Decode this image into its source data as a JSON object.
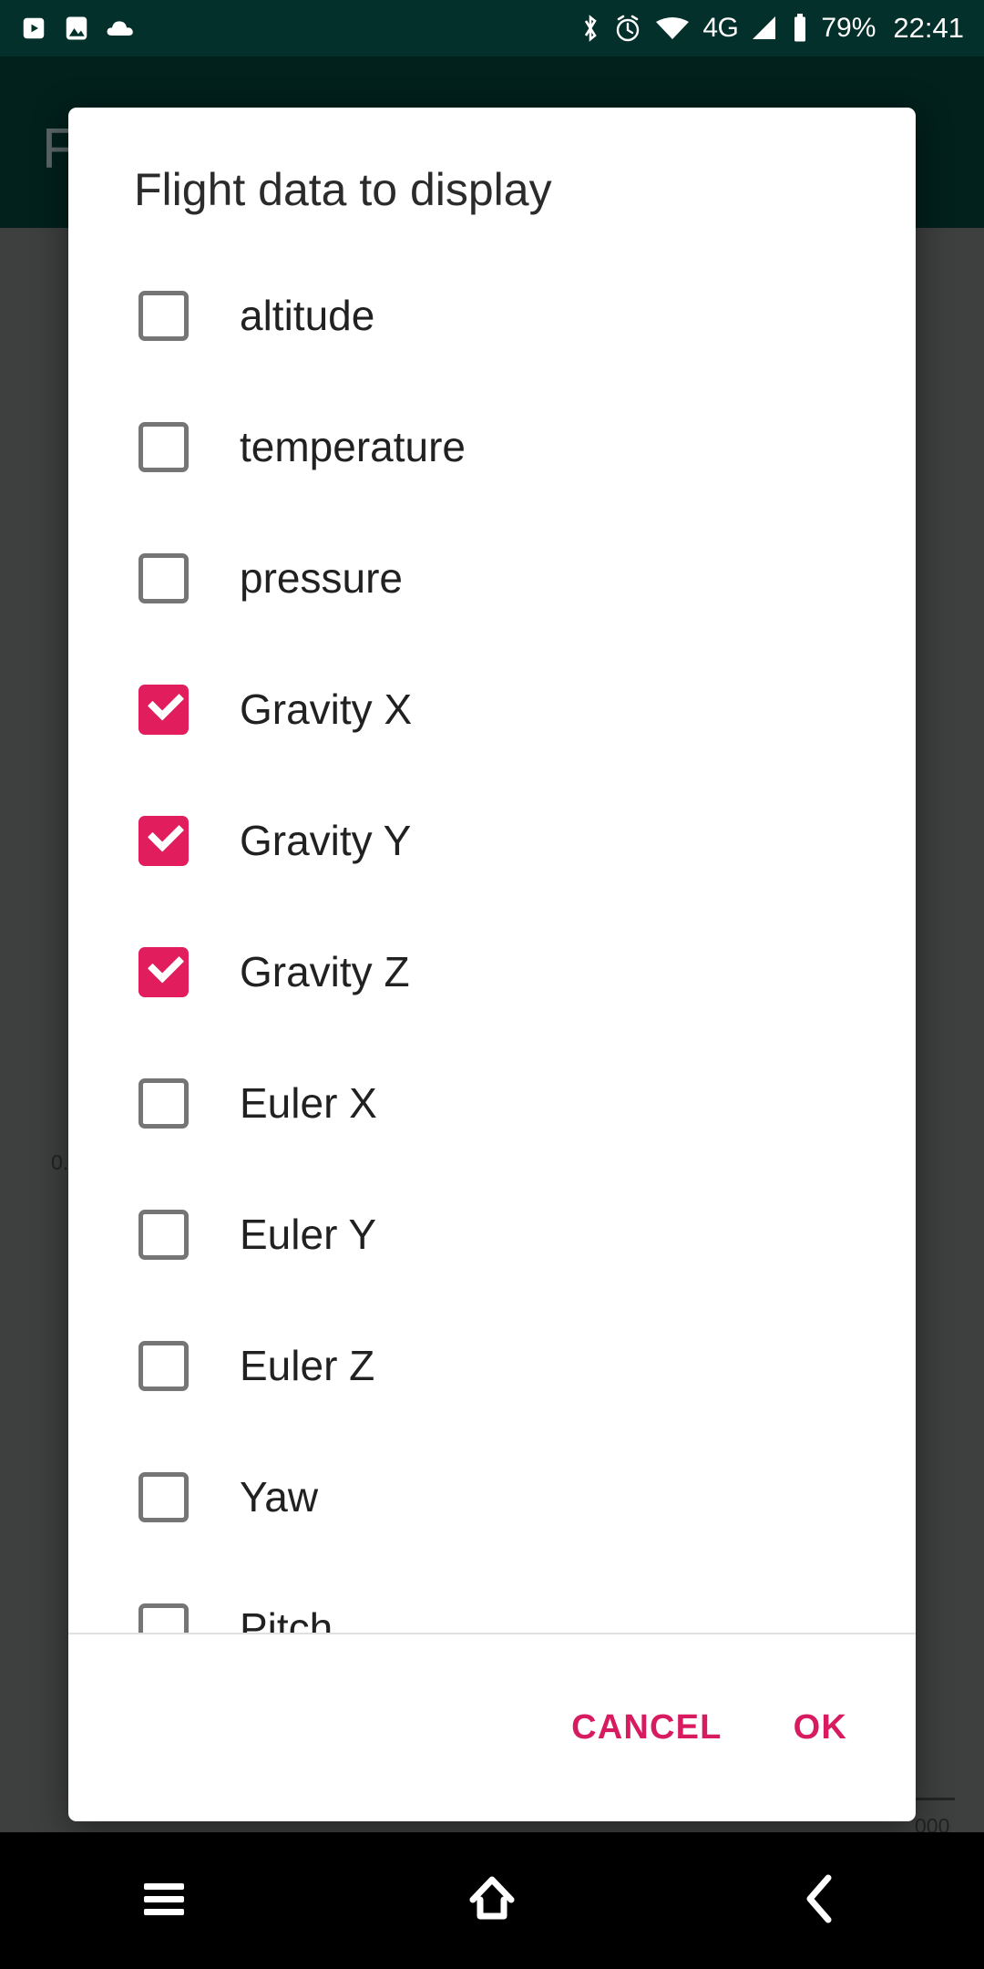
{
  "status_bar": {
    "background_color": "#04302b",
    "left_icons": [
      {
        "name": "youtube-icon"
      },
      {
        "name": "photos-icon"
      },
      {
        "name": "cloud-icon"
      }
    ],
    "right_icons": [
      {
        "name": "bluetooth-icon"
      },
      {
        "name": "alarm-icon"
      },
      {
        "name": "wifi-icon"
      }
    ],
    "network_type": "4G",
    "signal_icon": "signal-icon",
    "battery_icon": "battery-icon",
    "battery_percent": "79%",
    "clock": "22:41"
  },
  "background_app": {
    "app_bar_color": "#04302b",
    "title_fragment": "F",
    "chart_label_left": "0.",
    "chart_label_right": "000"
  },
  "dialog": {
    "title": "Flight data to display",
    "accent_color": "#e11d5e",
    "options": [
      {
        "label": "altitude",
        "checked": false
      },
      {
        "label": "temperature",
        "checked": false
      },
      {
        "label": "pressure",
        "checked": false
      },
      {
        "label": "Gravity X",
        "checked": true
      },
      {
        "label": "Gravity Y",
        "checked": true
      },
      {
        "label": "Gravity Z",
        "checked": true
      },
      {
        "label": "Euler X",
        "checked": false
      },
      {
        "label": "Euler Y",
        "checked": false
      },
      {
        "label": "Euler Z",
        "checked": false
      },
      {
        "label": "Yaw",
        "checked": false
      },
      {
        "label": "Pitch",
        "checked": false
      }
    ],
    "cancel_label": "CANCEL",
    "ok_label": "OK"
  },
  "nav_bar": {
    "background_color": "#000000",
    "buttons": [
      {
        "name": "recents-button",
        "icon": "menu-icon"
      },
      {
        "name": "home-button",
        "icon": "home-icon"
      },
      {
        "name": "back-button",
        "icon": "chevron-left-icon"
      }
    ]
  }
}
